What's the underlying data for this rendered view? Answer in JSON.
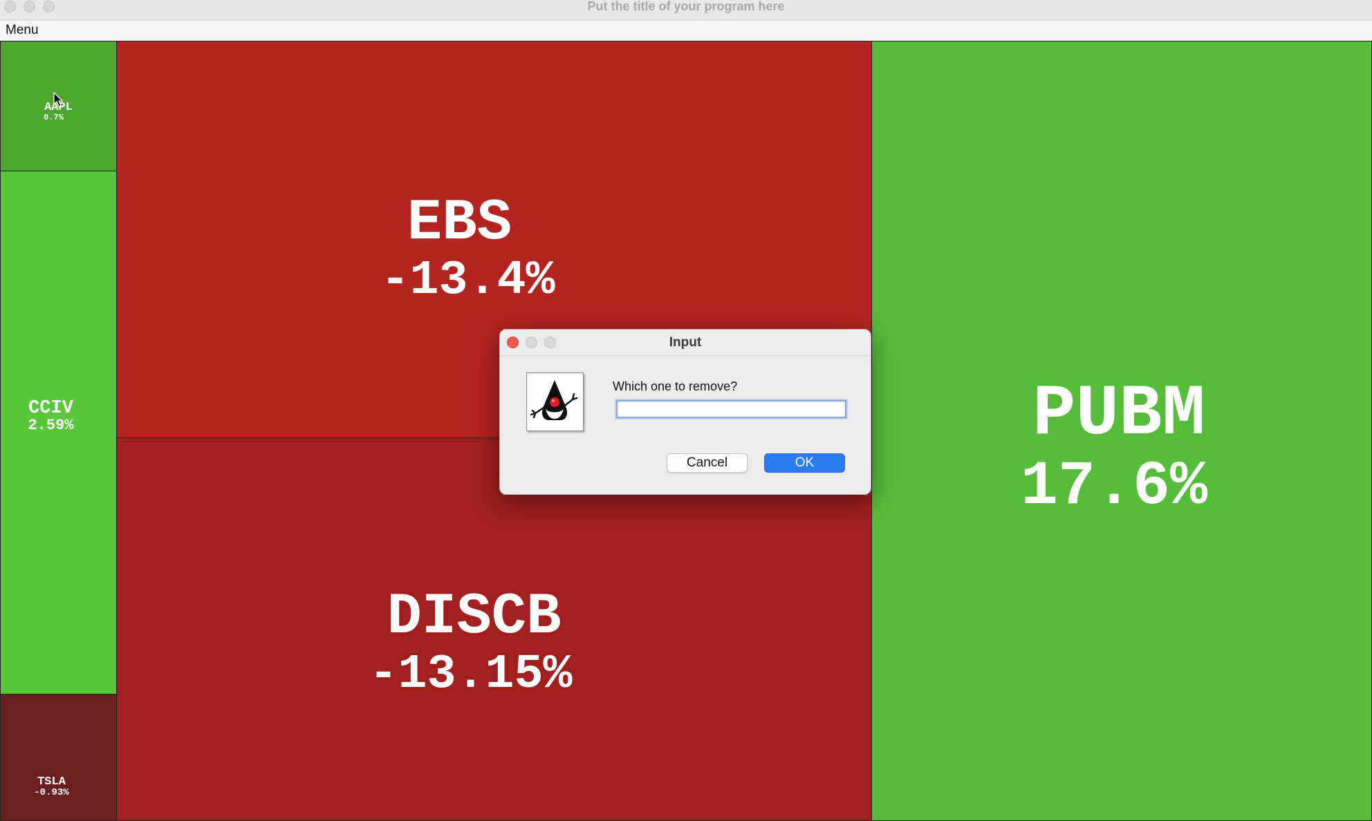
{
  "window": {
    "title": "Put the title of your program here"
  },
  "menu": {
    "label": "Menu"
  },
  "treemap": {
    "tiles": [
      {
        "ticker": "AAPL",
        "change": "0.7%",
        "color": "#4ea82f"
      },
      {
        "ticker": "CCIV",
        "change": "2.59%",
        "color": "#5ac73b"
      },
      {
        "ticker": "TSLA",
        "change": "-0.93%",
        "color": "#6b1e1e"
      },
      {
        "ticker": "EBS",
        "change": "-13.4%",
        "color": "#b32421"
      },
      {
        "ticker": "DISCB",
        "change": "-13.15%",
        "color": "#a11f1f"
      },
      {
        "ticker": "PUBM",
        "change": "17.6%",
        "color": "#56bd3a"
      }
    ]
  },
  "dialog": {
    "title": "Input",
    "prompt": "Which one to remove?",
    "input_value": "",
    "cancel_label": "Cancel",
    "ok_label": "OK",
    "icon": "java-duke-icon"
  }
}
